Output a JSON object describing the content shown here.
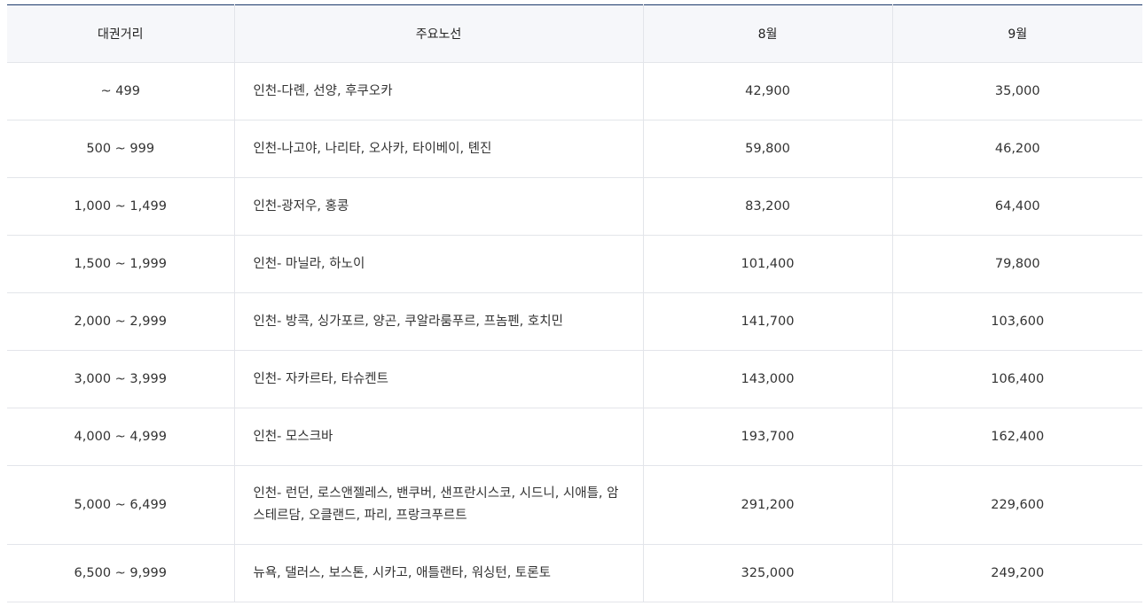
{
  "table": {
    "headers": [
      "대권거리",
      "주요노선",
      "8월",
      "9월"
    ],
    "rows": [
      {
        "distance": "~ 499",
        "routes": "인천-다롄, 선양, 후쿠오카",
        "aug": "42,900",
        "sep": "35,000"
      },
      {
        "distance": "500 ~ 999",
        "routes": "인천-나고야, 나리타, 오사카, 타이베이, 톈진",
        "aug": "59,800",
        "sep": "46,200"
      },
      {
        "distance": "1,000 ~ 1,499",
        "routes": "인천-광저우, 홍콩",
        "aug": "83,200",
        "sep": "64,400"
      },
      {
        "distance": "1,500 ~ 1,999",
        "routes": "인천- 마닐라, 하노이",
        "aug": "101,400",
        "sep": "79,800"
      },
      {
        "distance": "2,000 ~ 2,999",
        "routes": "인천- 방콕, 싱가포르, 양곤, 쿠알라룸푸르, 프놈펜, 호치민",
        "aug": "141,700",
        "sep": "103,600"
      },
      {
        "distance": "3,000 ~ 3,999",
        "routes": "인천- 자카르타, 타슈켄트",
        "aug": "143,000",
        "sep": "106,400"
      },
      {
        "distance": "4,000 ~ 4,999",
        "routes": "인천- 모스크바",
        "aug": "193,700",
        "sep": "162,400"
      },
      {
        "distance": "5,000 ~ 6,499",
        "routes": "인천- 런던, 로스앤젤레스, 밴쿠버, 샌프란시스코, 시드니, 시애틀, 암스테르담, 오클랜드, 파리, 프랑크푸르트",
        "aug": "291,200",
        "sep": "229,600"
      },
      {
        "distance": "6,500 ~ 9,999",
        "routes": "뉴욕, 댈러스, 보스톤, 시카고, 애틀랜타, 워싱턴, 토론토",
        "aug": "325,000",
        "sep": "249,200"
      }
    ]
  }
}
